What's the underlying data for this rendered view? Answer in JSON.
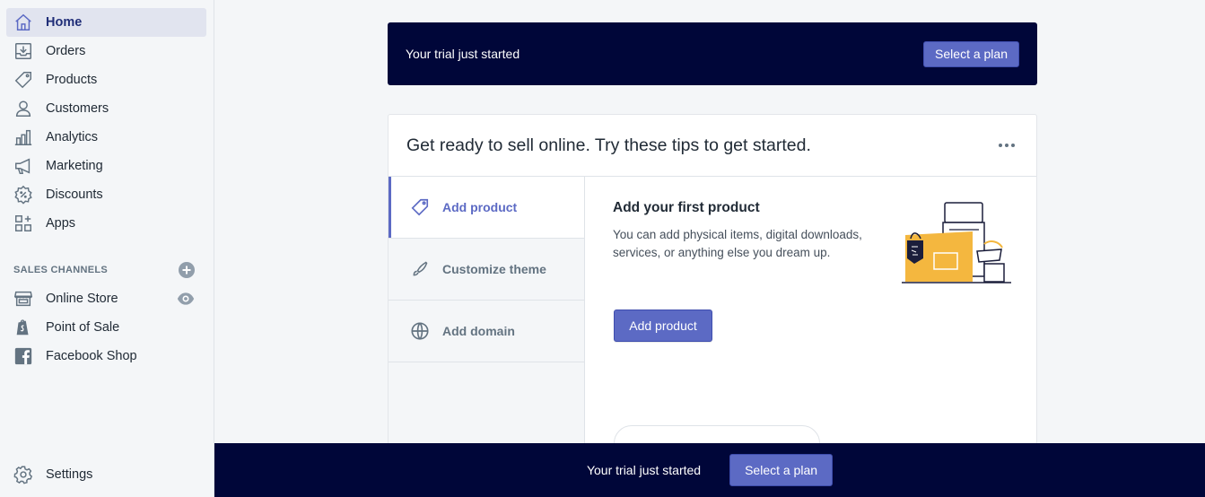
{
  "sidebar": {
    "items": [
      {
        "label": "Home",
        "icon": "home-icon"
      },
      {
        "label": "Orders",
        "icon": "orders-icon"
      },
      {
        "label": "Products",
        "icon": "tag-icon"
      },
      {
        "label": "Customers",
        "icon": "person-icon"
      },
      {
        "label": "Analytics",
        "icon": "bar-chart-icon"
      },
      {
        "label": "Marketing",
        "icon": "megaphone-icon"
      },
      {
        "label": "Discounts",
        "icon": "discount-icon"
      },
      {
        "label": "Apps",
        "icon": "apps-icon"
      }
    ],
    "sales_channels_title": "SALES CHANNELS",
    "channels": [
      {
        "label": "Online Store",
        "icon": "store-icon"
      },
      {
        "label": "Point of Sale",
        "icon": "shopify-bag-icon"
      },
      {
        "label": "Facebook Shop",
        "icon": "facebook-icon"
      }
    ],
    "settings_label": "Settings"
  },
  "trial_banner": {
    "text": "Your trial just started",
    "button": "Select a plan"
  },
  "card": {
    "title": "Get ready to sell online. Try these tips to get started.",
    "tabs": [
      {
        "label": "Add product",
        "icon": "tag-icon"
      },
      {
        "label": "Customize theme",
        "icon": "brush-icon"
      },
      {
        "label": "Add domain",
        "icon": "globe-icon"
      }
    ],
    "panel": {
      "heading": "Add your first product",
      "description": "You can add physical items, digital downloads, services, or anything else you dream up.",
      "button": "Add product"
    }
  },
  "bottom_bar": {
    "text": "Your trial just started",
    "button": "Select a plan"
  },
  "colors": {
    "accent": "#5c6ac4",
    "banner": "#000639",
    "active_nav_bg": "#e1e4ef",
    "active_nav_text": "#202e78"
  }
}
